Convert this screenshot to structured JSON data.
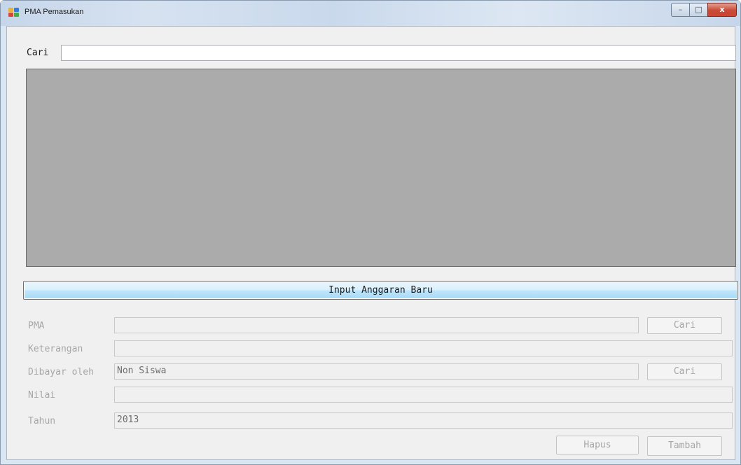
{
  "window": {
    "title": "PMA Pemasukan",
    "controls": {
      "minimize": "–",
      "maximize": "□",
      "close": "x"
    }
  },
  "search": {
    "label": "Cari",
    "value": ""
  },
  "primary_button": {
    "label": "Input Anggaran Baru"
  },
  "form": {
    "pma": {
      "label": "PMA",
      "value": "",
      "button": "Cari"
    },
    "keterangan": {
      "label": "Keterangan",
      "value": ""
    },
    "dibayar_oleh": {
      "label": "Dibayar oleh",
      "value": "Non Siswa",
      "button": "Cari"
    },
    "nilai": {
      "label": "Nilai",
      "value": ""
    },
    "tahun": {
      "label": "Tahun",
      "value": "2013"
    }
  },
  "actions": {
    "hapus": "Hapus",
    "tambah": "Tambah"
  },
  "colors": {
    "accent": "#3c7fb1",
    "grid_background": "#ababab",
    "close_button": "#c84a36"
  }
}
